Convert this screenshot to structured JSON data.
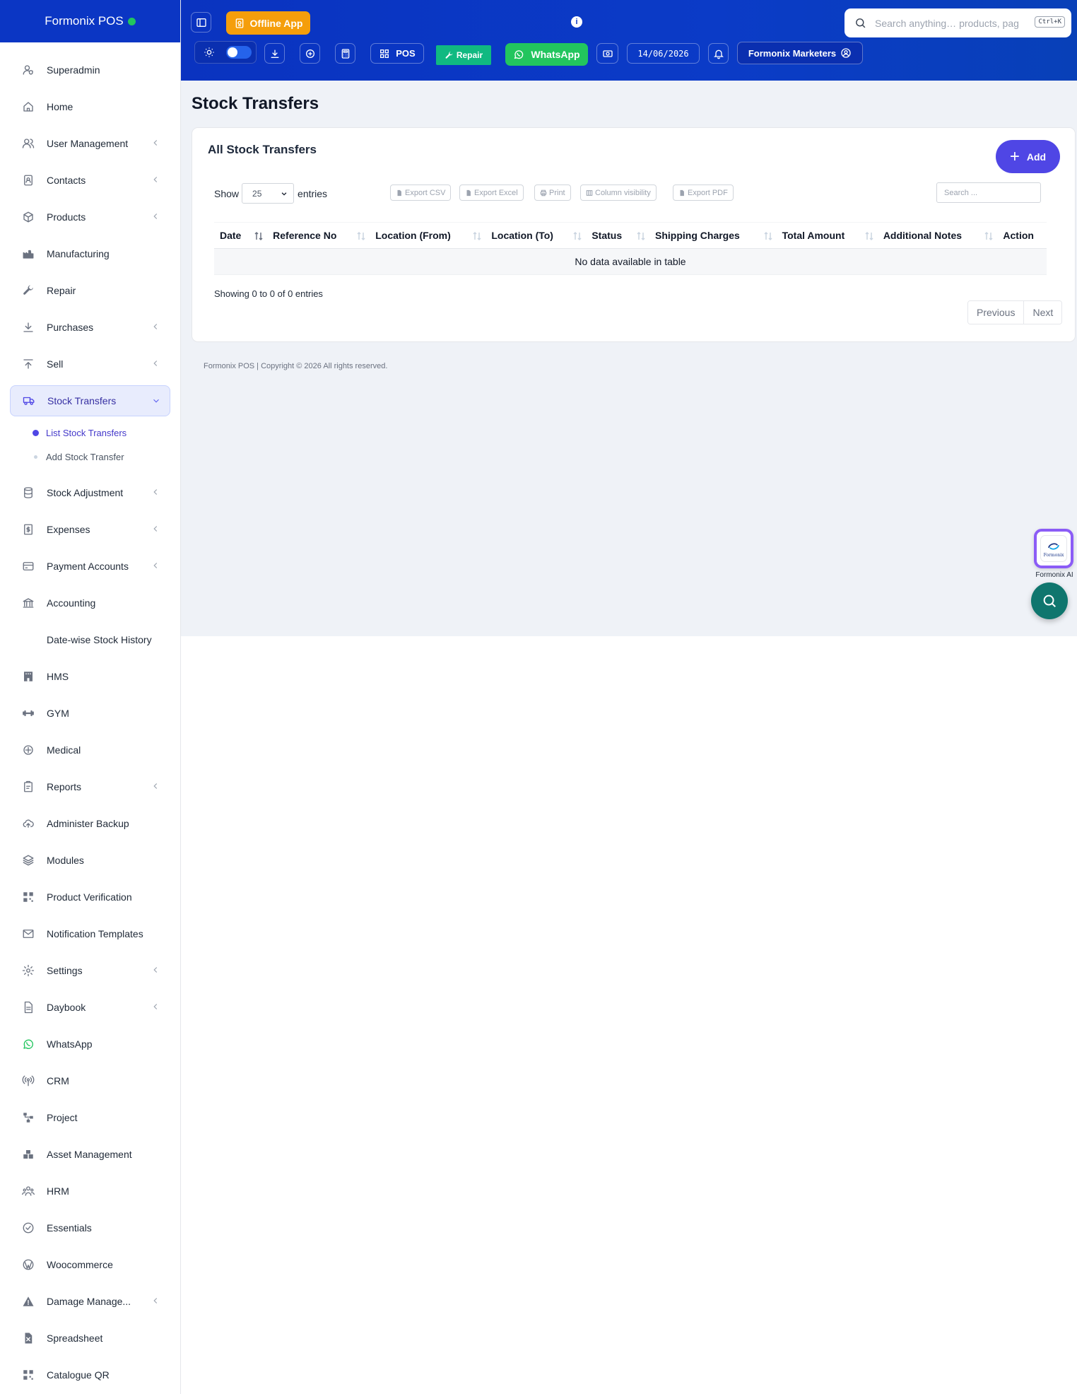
{
  "brand": {
    "name": "Formonix POS",
    "status_color": "#22c55e"
  },
  "header": {
    "offline_label": "Offline App",
    "pos_label": "POS",
    "repair_label": "Repair",
    "whatsapp_label": "WhatsApp",
    "date": "14/06/2026",
    "user_name": "Formonix Marketers",
    "search_placeholder": "Search anything… products, pag",
    "search_shortcut": "Ctrl+K",
    "colors": {
      "header_bg": "#0b36c4",
      "offline_bg": "#f59e0b",
      "repair_bg": "#10b981",
      "whatsapp_bg": "#22c55e"
    }
  },
  "sidebar": {
    "items": [
      {
        "label": "Superadmin",
        "icon": "user-shield-icon",
        "chevron": false
      },
      {
        "label": "Home",
        "icon": "home-icon",
        "chevron": false
      },
      {
        "label": "User Management",
        "icon": "users-icon",
        "chevron": true
      },
      {
        "label": "Contacts",
        "icon": "contact-book-icon",
        "chevron": true
      },
      {
        "label": "Products",
        "icon": "cube-icon",
        "chevron": true
      },
      {
        "label": "Manufacturing",
        "icon": "factory-icon",
        "chevron": false
      },
      {
        "label": "Repair",
        "icon": "wrench-icon",
        "chevron": false
      },
      {
        "label": "Purchases",
        "icon": "download-icon",
        "chevron": true
      },
      {
        "label": "Sell",
        "icon": "upload-icon",
        "chevron": true
      },
      {
        "label": "Stock Transfers",
        "icon": "truck-icon",
        "chevron": true,
        "active": true
      },
      {
        "label": "Stock Adjustment",
        "icon": "database-icon",
        "chevron": true
      },
      {
        "label": "Expenses",
        "icon": "receipt-icon",
        "chevron": true
      },
      {
        "label": "Payment Accounts",
        "icon": "credit-card-icon",
        "chevron": true
      },
      {
        "label": "Accounting",
        "icon": "bank-icon",
        "chevron": false
      },
      {
        "label": "Date-wise Stock History",
        "icon": "",
        "chevron": false
      },
      {
        "label": "HMS",
        "icon": "hotel-icon",
        "chevron": false
      },
      {
        "label": "GYM",
        "icon": "dumbbell-icon",
        "chevron": false
      },
      {
        "label": "Medical",
        "icon": "medical-icon",
        "chevron": false
      },
      {
        "label": "Reports",
        "icon": "report-icon",
        "chevron": true
      },
      {
        "label": "Administer Backup",
        "icon": "cloud-upload-icon",
        "chevron": false
      },
      {
        "label": "Modules",
        "icon": "layers-icon",
        "chevron": false
      },
      {
        "label": "Product Verification",
        "icon": "qr-icon",
        "chevron": false
      },
      {
        "label": "Notification Templates",
        "icon": "envelope-icon",
        "chevron": false
      },
      {
        "label": "Settings",
        "icon": "gear-icon",
        "chevron": true
      },
      {
        "label": "Daybook",
        "icon": "document-icon",
        "chevron": true
      },
      {
        "label": "WhatsApp",
        "icon": "whatsapp-icon",
        "chevron": false
      },
      {
        "label": "CRM",
        "icon": "broadcast-icon",
        "chevron": false
      },
      {
        "label": "Project",
        "icon": "project-icon",
        "chevron": false
      },
      {
        "label": "Asset Management",
        "icon": "boxes-icon",
        "chevron": false
      },
      {
        "label": "HRM",
        "icon": "team-icon",
        "chevron": false
      },
      {
        "label": "Essentials",
        "icon": "check-circle-icon",
        "chevron": false
      },
      {
        "label": "Woocommerce",
        "icon": "wordpress-icon",
        "chevron": false
      },
      {
        "label": "Damage Manage...",
        "icon": "warning-icon",
        "chevron": true
      },
      {
        "label": "Spreadsheet",
        "icon": "spreadsheet-icon",
        "chevron": false
      },
      {
        "label": "Catalogue QR",
        "icon": "qr-icon",
        "chevron": false
      }
    ],
    "subitems": [
      {
        "label": "List Stock Transfers",
        "active": true
      },
      {
        "label": "Add Stock Transfer",
        "active": false
      }
    ]
  },
  "main": {
    "page_title": "Stock Transfers",
    "card_title": "All Stock Transfers",
    "add_label": "Add",
    "show_label": "Show",
    "entries_label": "entries",
    "page_length": "25",
    "export_buttons": [
      "Export CSV",
      "Export Excel",
      "Print",
      "Column visibility",
      "Export PDF"
    ],
    "table_search_placeholder": "Search ...",
    "columns": [
      "Date",
      "Reference No",
      "Location (From)",
      "Location (To)",
      "Status",
      "Shipping Charges",
      "Total Amount",
      "Additional Notes",
      "Action"
    ],
    "empty_message": "No data available in table",
    "info": "Showing 0 to 0 of 0 entries",
    "pagination": {
      "previous": "Previous",
      "next": "Next"
    },
    "accent_color": "#4f46e5"
  },
  "footer": {
    "text": "Formonix POS | Copyright © 2026 All rights reserved."
  },
  "floating": {
    "ai_label": "Formonix AI",
    "ai_logo_text": "Formonix"
  }
}
